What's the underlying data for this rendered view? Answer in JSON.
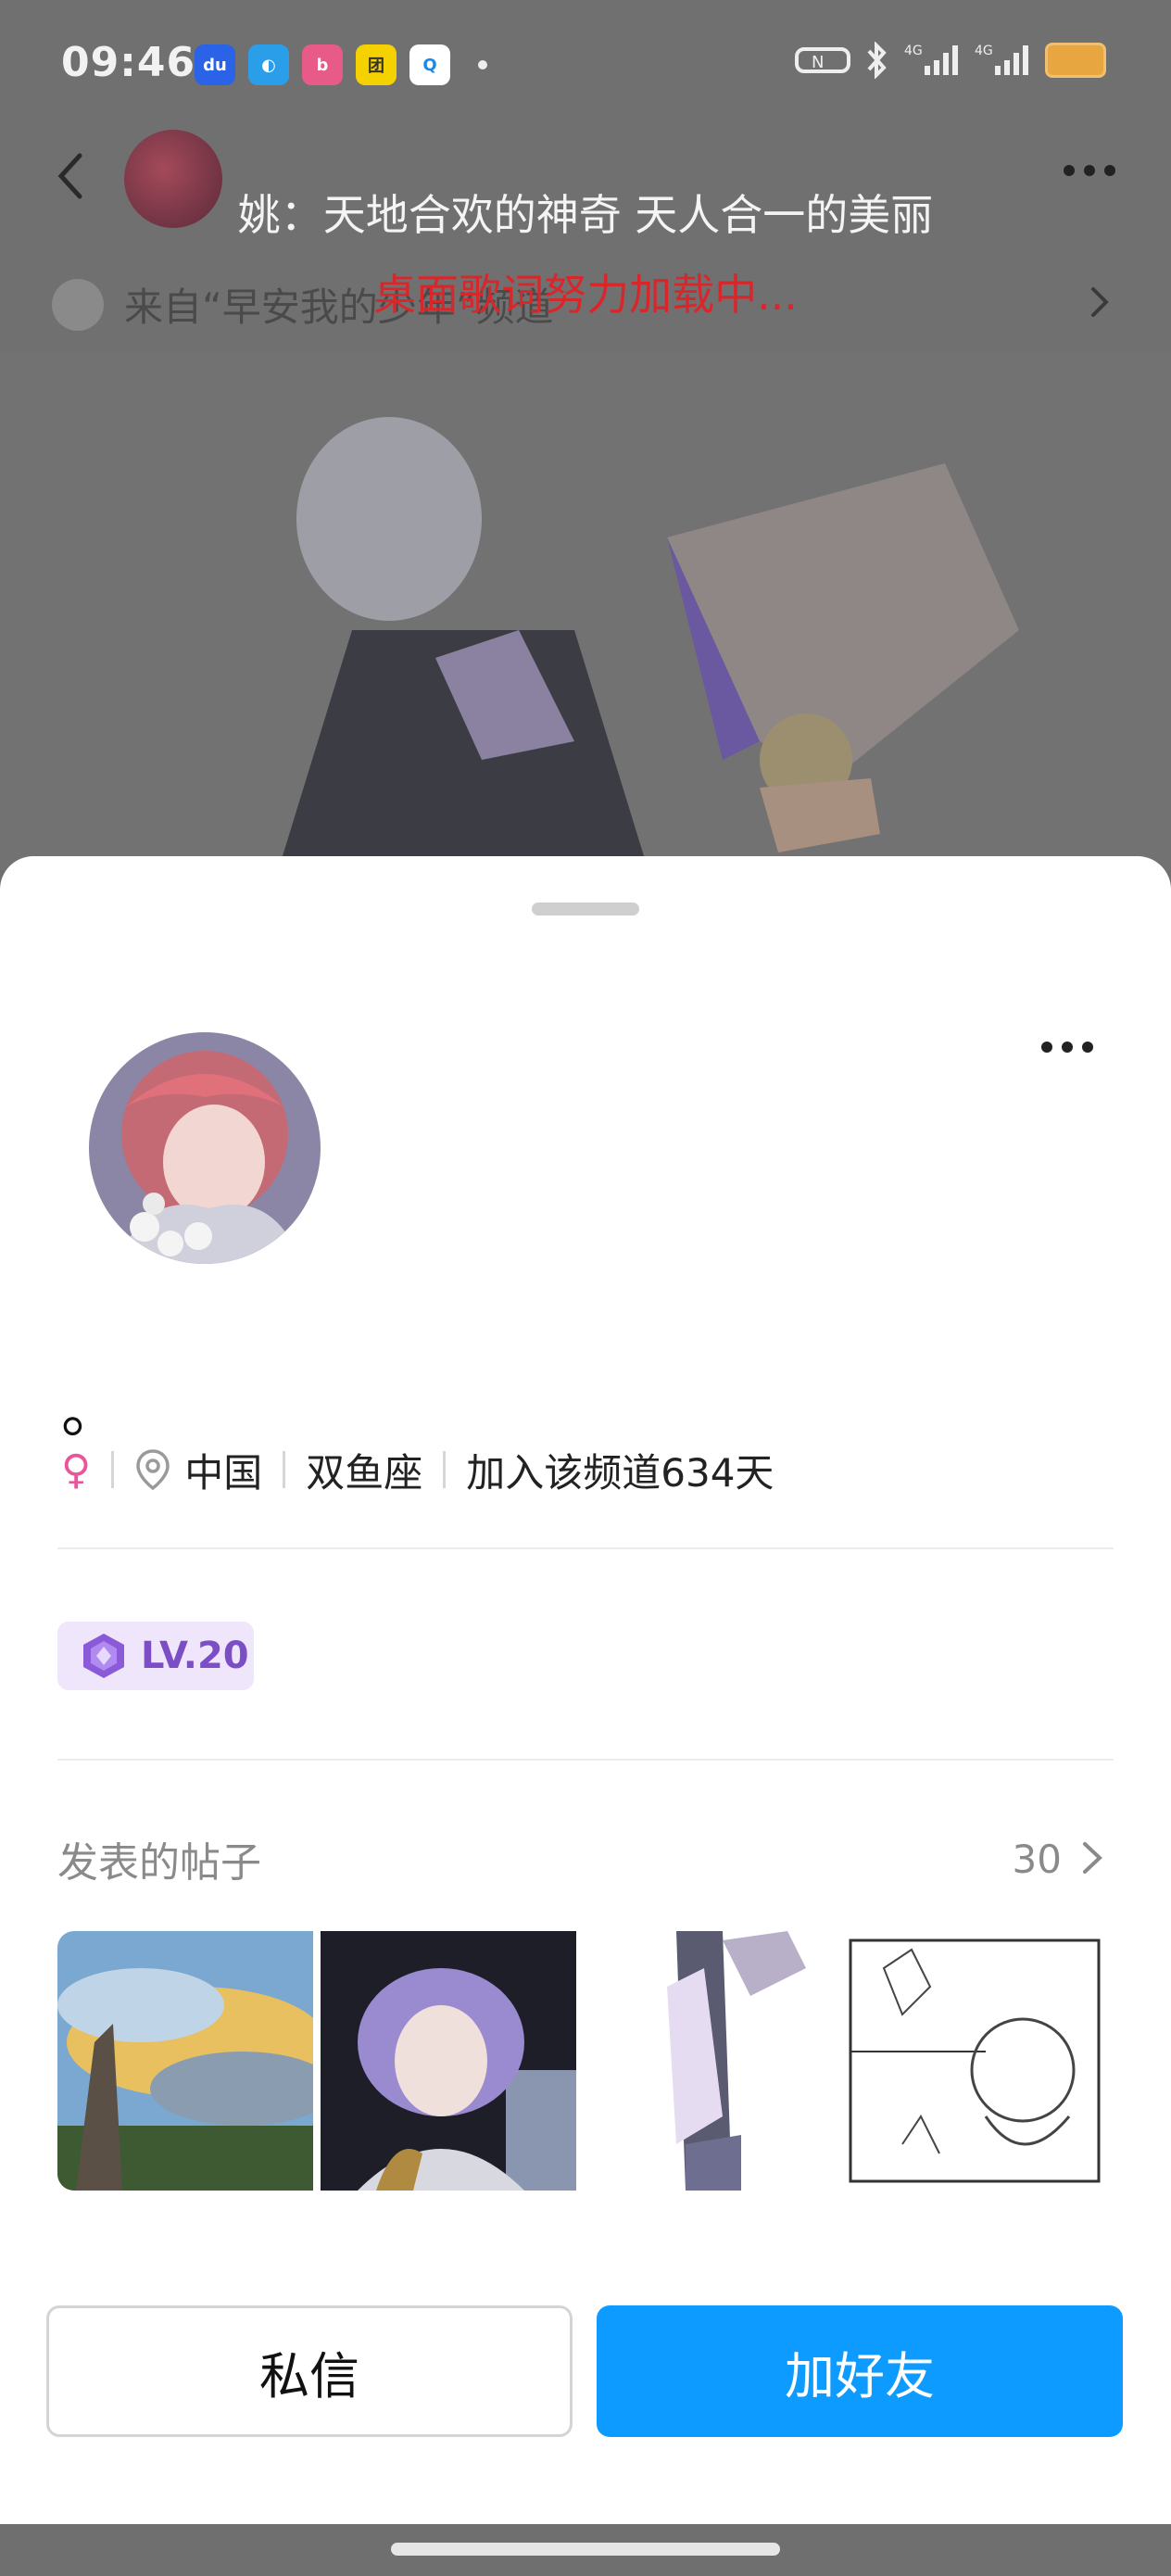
{
  "status_bar": {
    "time": "09:46",
    "apps": [
      "baidu-icon",
      "browser-icon",
      "bilibili-icon",
      "tuan-icon",
      "qq-browser-icon"
    ],
    "right_icons": [
      "nfc-icon",
      "bluetooth-icon",
      "signal-4g-icon",
      "signal-4g-icon",
      "battery-icon"
    ]
  },
  "background_page": {
    "lyric_line_1": "姚：天地合欢的神奇 天人合一的美丽",
    "lyric_line_2": "桌面歌词努力加载中...",
    "from_text": "来自“早安我的少年”频道"
  },
  "profile": {
    "nickname": "。",
    "gender_symbol": "♀",
    "location": "中国",
    "zodiac": "双鱼座",
    "joined": "加入该频道634天",
    "level": "LV.20"
  },
  "posts": {
    "title": "发表的帖子",
    "count": "30"
  },
  "actions": {
    "message": "私信",
    "add_friend": "加好友"
  },
  "colors": {
    "accent": "#0d9bff",
    "level_text": "#7b4ec6",
    "gender": "#e9549b",
    "lyric_loading": "#d8272b"
  }
}
